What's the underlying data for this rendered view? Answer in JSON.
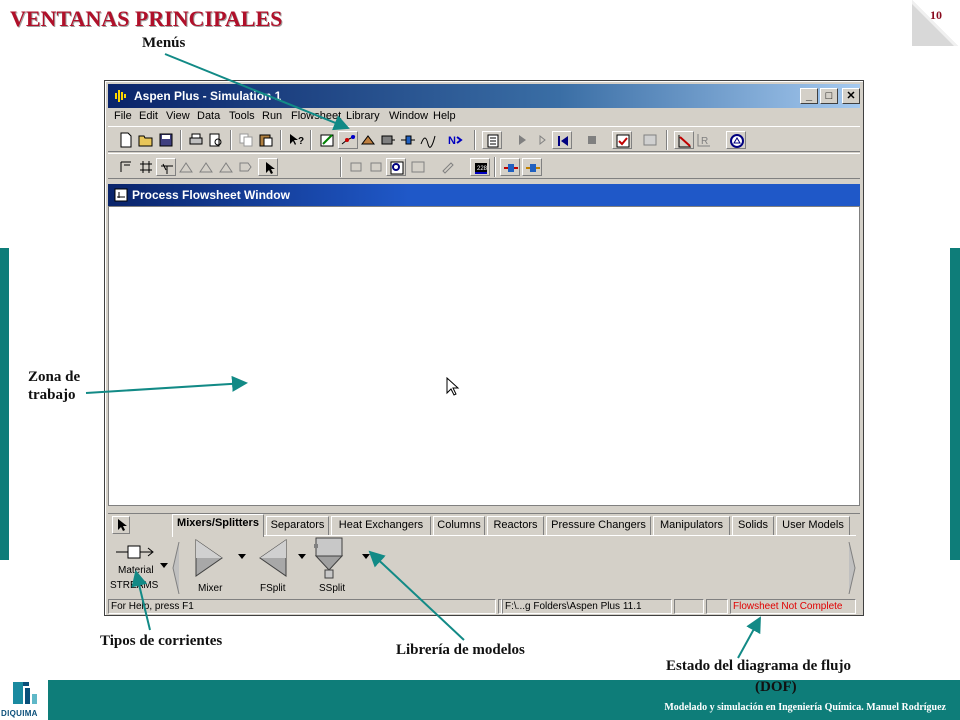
{
  "slide": {
    "title": "VENTANAS PRINCIPALES",
    "page_number": "10",
    "footer": "Modelado y simulación en Ingeniería Química.  Manuel Rodríguez",
    "logo_text": "DIQUIMA",
    "accent_color": "#0e7d79",
    "title_color": "#b0102a"
  },
  "annotations": {
    "menus": "Menús",
    "work_area_line1": "Zona de",
    "work_area_line2": "trabajo",
    "stream_types": "Tipos de corrientes",
    "model_library": "Librería de modelos",
    "flowsheet_status_line1": "Estado del diagrama de flujo",
    "flowsheet_status_line2": "(DOF)"
  },
  "window": {
    "title": "Aspen Plus - Simulation 1",
    "minimize": "_",
    "maximize": "□",
    "close": "✕"
  },
  "menu": [
    "File",
    "Edit",
    "View",
    "Data",
    "Tools",
    "Run",
    "Flowsheet",
    "Library",
    "Window",
    "Help"
  ],
  "flowsheet_window": {
    "title": "Process Flowsheet Window"
  },
  "palette": {
    "tabs": [
      "Mixers/Splitters",
      "Separators",
      "Heat Exchangers",
      "Columns",
      "Reactors",
      "Pressure Changers",
      "Manipulators",
      "Solids",
      "User Models"
    ],
    "active_tab": "Mixers/Splitters",
    "stream_label": "Material",
    "streams_caption": "STREAMS",
    "models": [
      "Mixer",
      "FSplit",
      "SSplit"
    ]
  },
  "status_bar": {
    "help": "For Help, press F1",
    "path": "F:\\...g Folders\\Aspen Plus 11.1",
    "flowsheet_status": "Flowsheet Not Complete",
    "status_color": "#e00000"
  }
}
